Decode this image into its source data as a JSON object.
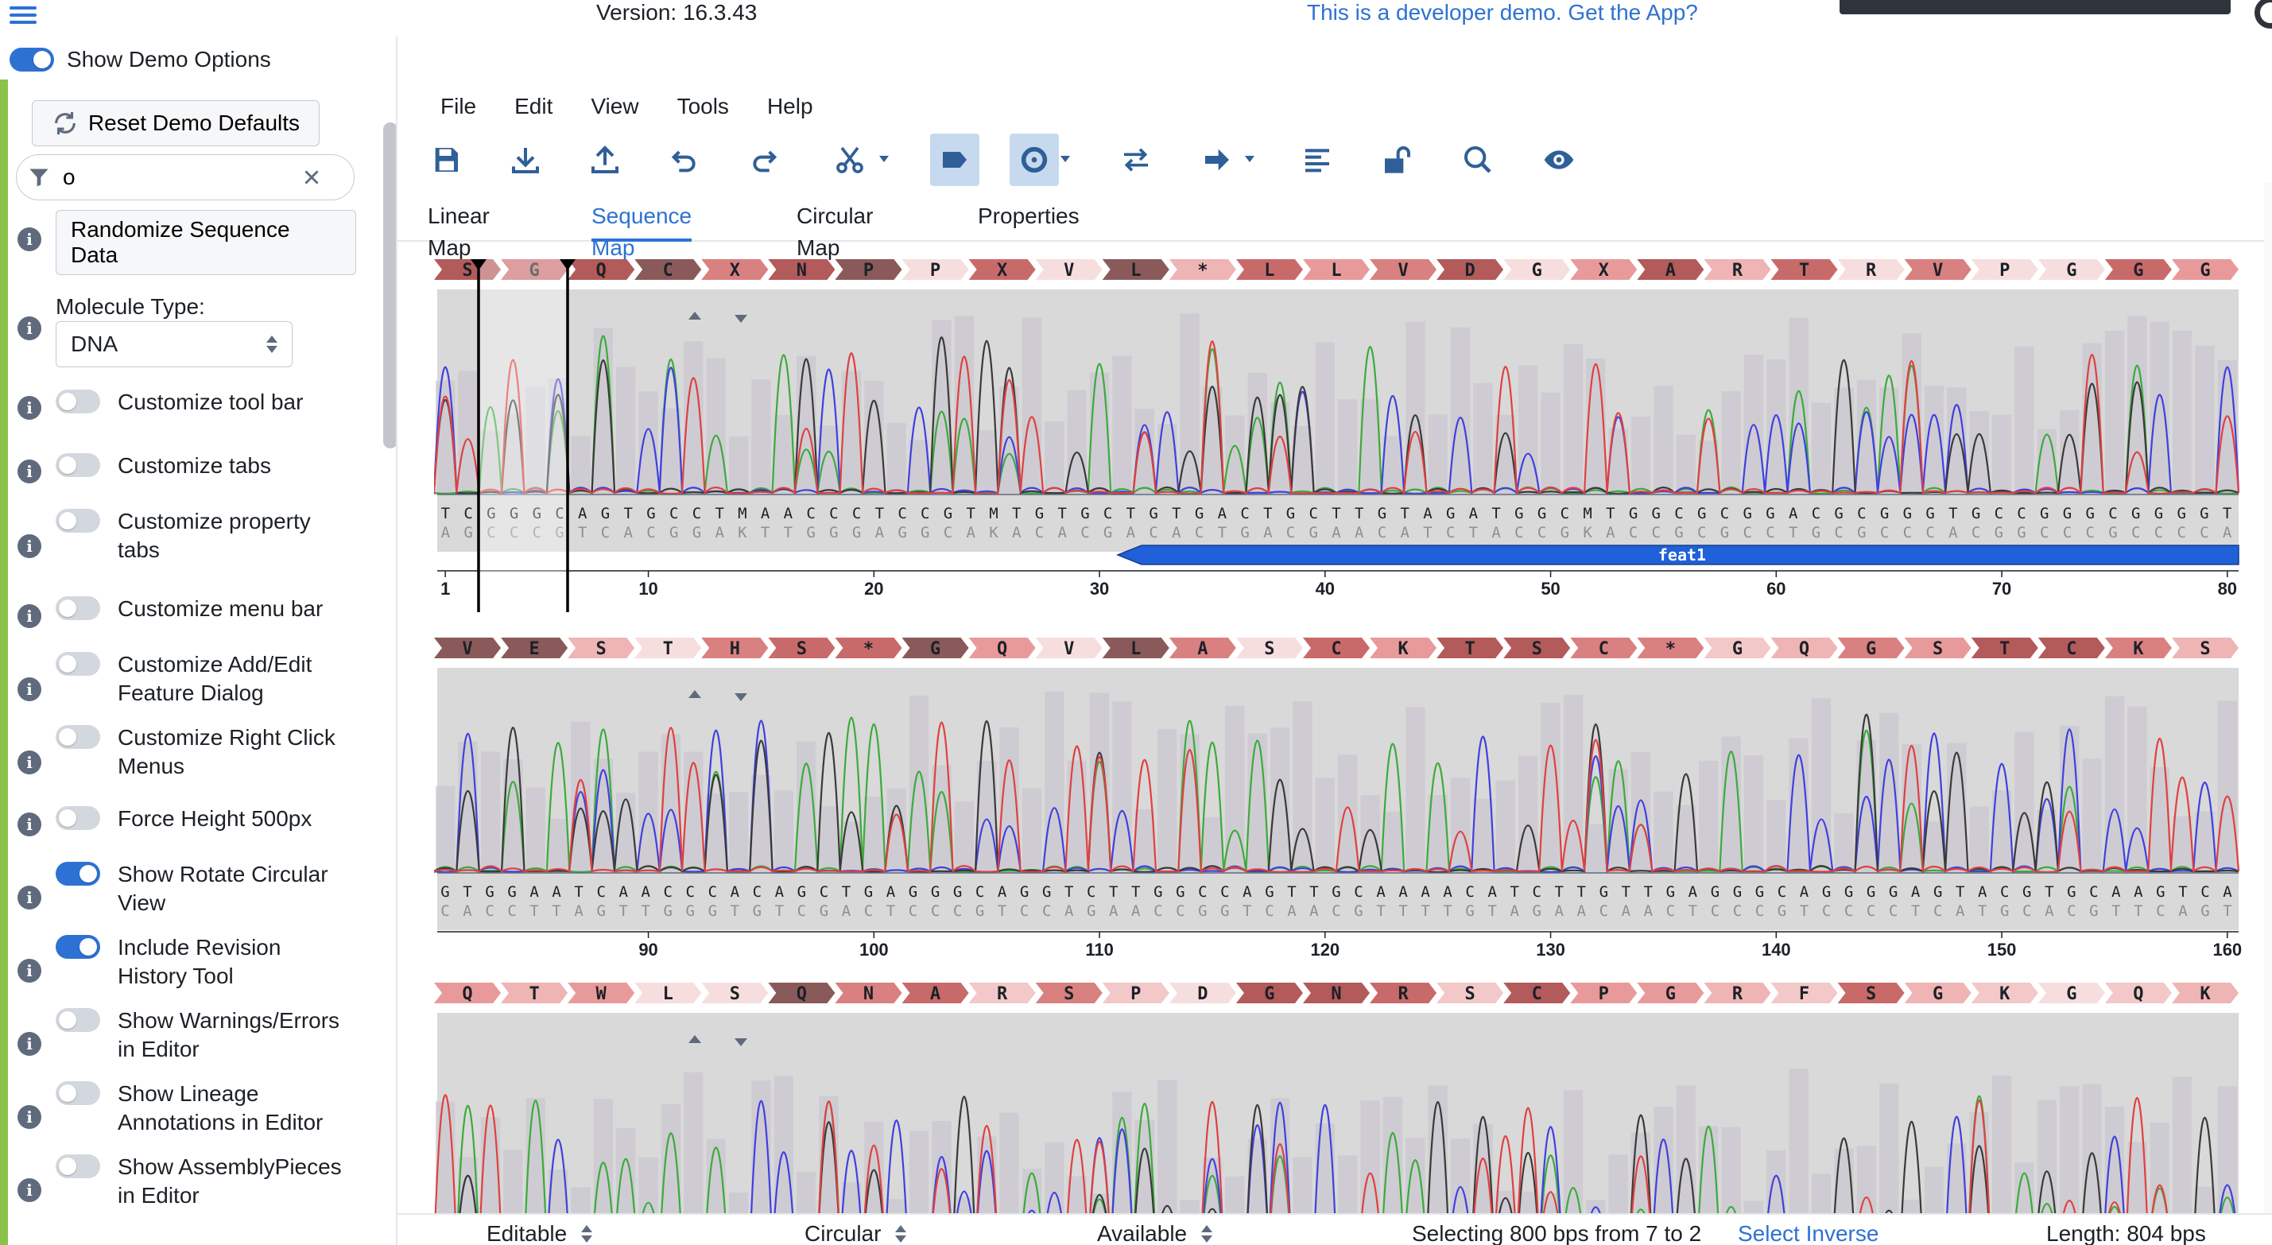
{
  "header": {
    "version": "Version: 16.3.43",
    "dev_note": "This is a developer demo. Get the App?"
  },
  "demo_panel": {
    "show_demo_label": "Show Demo Options",
    "show_demo_on": true,
    "reset_label": "Reset Demo Defaults",
    "filter_value": "o",
    "randomize_label": "Randomize Sequence Data",
    "molecule_type_label": "Molecule Type:",
    "molecule_type_value": "DNA",
    "options": [
      {
        "label": "Customize tool bar",
        "on": false
      },
      {
        "label": "Customize tabs",
        "on": false
      },
      {
        "label": "Customize property tabs",
        "on": false
      },
      {
        "label": "Customize menu bar",
        "on": false
      },
      {
        "label": "Customize Add/Edit Feature Dialog",
        "on": false
      },
      {
        "label": "Customize Right Click Menus",
        "on": false
      },
      {
        "label": "Force Height 500px",
        "on": false
      },
      {
        "label": "Show Rotate Circular View",
        "on": true
      },
      {
        "label": "Include Revision History Tool",
        "on": true
      },
      {
        "label": "Show Warnings/Errors in Editor",
        "on": false
      },
      {
        "label": "Show Lineage Annotations in Editor",
        "on": false
      },
      {
        "label": "Show AssemblyPieces in Editor",
        "on": false
      }
    ]
  },
  "menu": [
    "File",
    "Edit",
    "View",
    "Tools",
    "Help"
  ],
  "toolbar": [
    "save-icon",
    "download-icon",
    "upload-icon",
    "undo-icon",
    "redo-icon",
    "cut-icon",
    "feature-label-icon",
    "circular-icon",
    "swap-icon",
    "arrow-right-icon",
    "align-left-icon",
    "lock-open-icon",
    "search-icon",
    "eye-icon"
  ],
  "tabs": [
    "Linear Map",
    "Sequence Map",
    "Circular Map",
    "Properties"
  ],
  "active_tab": "Sequence Map",
  "sequence": {
    "rows": [
      {
        "aa": "SGQCXNPPXVL*LLVDGXARTRVPGGG",
        "top": "TCGGGCAGTGCCTMAACCCTCCGTMTGTGCTGTGACTGCTTGTAGATGGCMTGGCGCGGACGCGGGTGCCGGGCGGGGT",
        "bottom": "AGCCCGTCACGGAKTTGGGAGGCAKACACGACACTGACGAACATCTACCGKACCGCGCCTGCGCCCACGGCCCGCCCCA",
        "ticks": [
          "1",
          "10",
          "20",
          "30",
          "40",
          "50",
          "60",
          "70",
          "80"
        ],
        "feature": "feat1"
      },
      {
        "aa": "VESTHS*GQVLASCKTSC*GQGSTCKS",
        "top": "GTGGAATCAACCCACAGCTGAGGGCAGGTCTTGGCCAGTTGCAAAACATCTTGTTGAGGGCAGGGGAGTACGTGCAAGTCA",
        "bottom": "CACCTTAGTTGGGTGTCGACTCCCGTCCAGAACCGGTCAACGTTTTGTAGAACAACTCCCGTCCCCTCATGCACGTTCAGT",
        "ticks": [
          "90",
          "100",
          "110",
          "120",
          "130",
          "140",
          "150",
          "160"
        ]
      },
      {
        "aa": "QTWLSQNARSPDGNRSCPGRFSGKGQK"
      }
    ]
  },
  "status": {
    "editable": "Editable",
    "topology": "Circular",
    "availability": "Available",
    "selection": "Selecting 800 bps from 7 to 2",
    "select_inverse": "Select Inverse",
    "length": "Length: 804 bps"
  },
  "colors": {
    "accent": "#2d72d2",
    "sidebar_strip": "#8bc34a",
    "trace_A": "#3bab3b",
    "trace_C": "#4040e0",
    "trace_G": "#3a3a3a",
    "trace_T": "#e04040",
    "feature": "#2060d8"
  }
}
